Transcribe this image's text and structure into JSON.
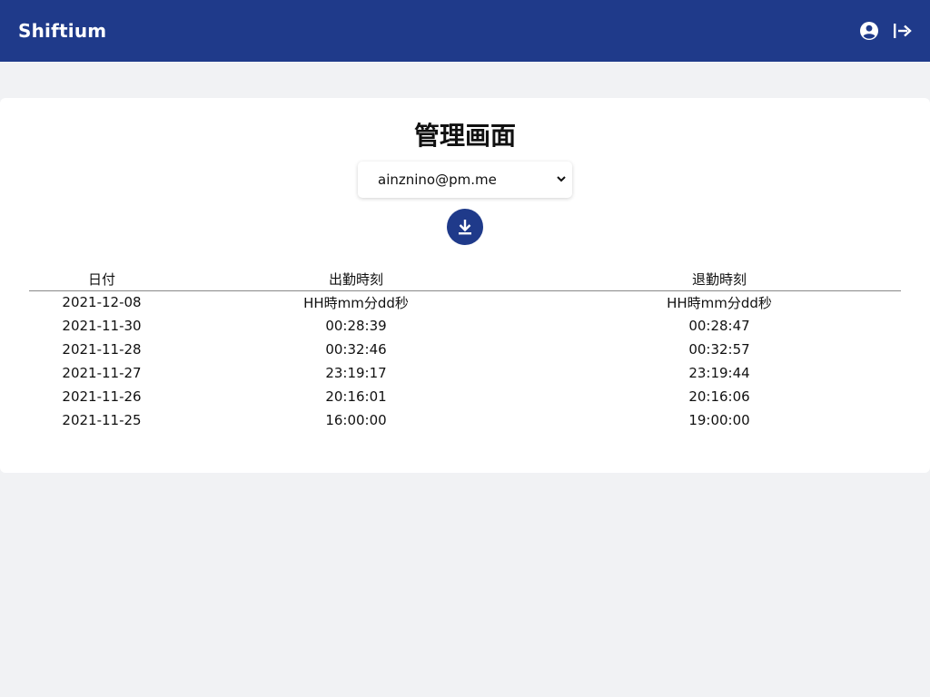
{
  "header": {
    "brand": "Shiftium",
    "icons": [
      "account-circle-icon",
      "logout-icon"
    ]
  },
  "main": {
    "title": "管理画面",
    "user_select": {
      "selected": "ainznino@pm.me",
      "options": [
        "ainznino@pm.me"
      ]
    },
    "download_icon": "download-icon"
  },
  "table": {
    "columns": [
      "日付",
      "出勤時刻",
      "退勤時刻"
    ],
    "rows": [
      [
        "2021-12-08",
        "HH時mm分dd秒",
        "HH時mm分dd秒"
      ],
      [
        "2021-11-30",
        "00:28:39",
        "00:28:47"
      ],
      [
        "2021-11-28",
        "00:32:46",
        "00:32:57"
      ],
      [
        "2021-11-27",
        "23:19:17",
        "23:19:44"
      ],
      [
        "2021-11-26",
        "20:16:01",
        "20:16:06"
      ],
      [
        "2021-11-25",
        "16:00:00",
        "19:00:00"
      ]
    ]
  },
  "colors": {
    "primary": "#1f3a8a",
    "background": "#f1f2f4",
    "card": "#ffffff"
  }
}
